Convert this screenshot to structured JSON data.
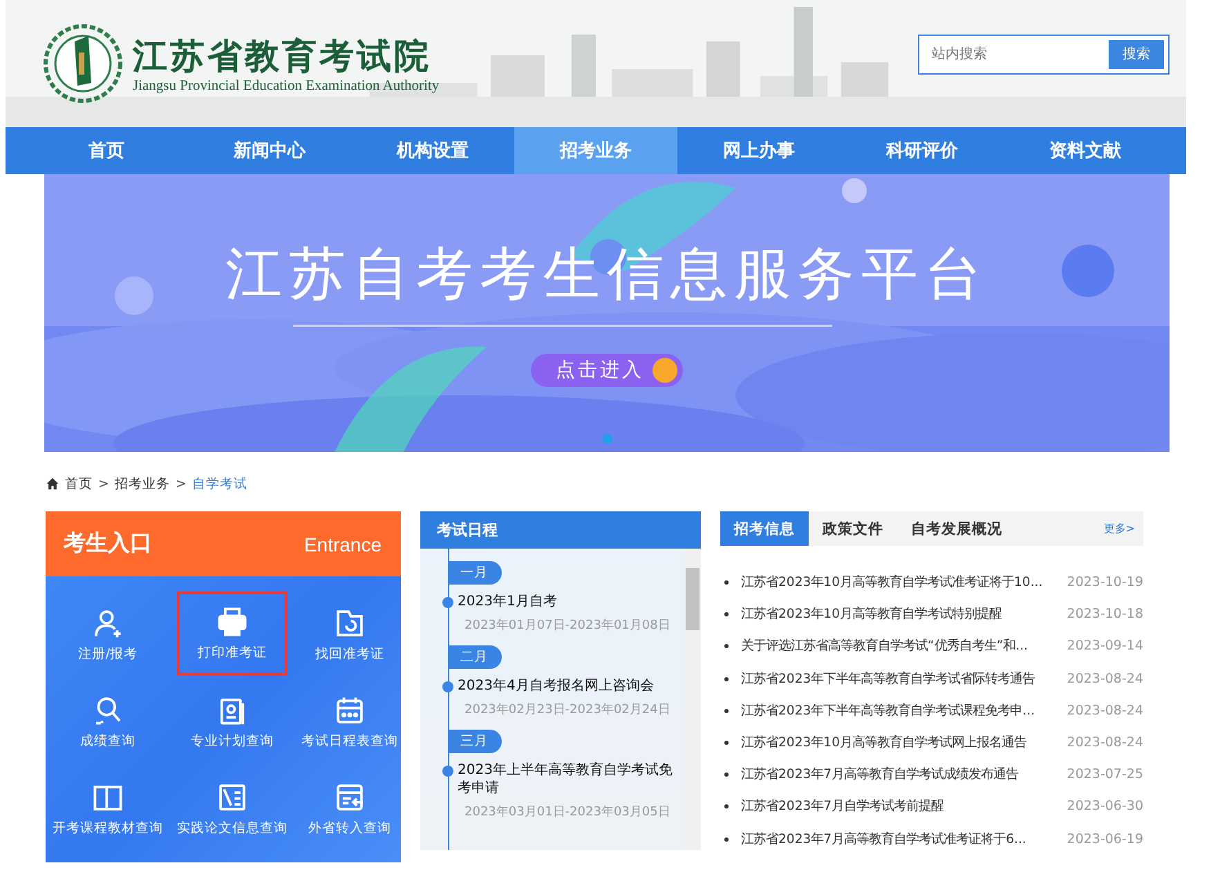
{
  "header": {
    "site_name": "江苏省教育考试院",
    "site_name_en": "Jiangsu Provincial Education Examination Authority",
    "search": {
      "placeholder": "站内搜索",
      "button": "搜索"
    }
  },
  "nav": [
    {
      "label": "首页",
      "selected": false
    },
    {
      "label": "新闻中心",
      "selected": false
    },
    {
      "label": "机构设置",
      "selected": false
    },
    {
      "label": "招考业务",
      "selected": true
    },
    {
      "label": "网上办事",
      "selected": false
    },
    {
      "label": "科研评价",
      "selected": false
    },
    {
      "label": "资料文献",
      "selected": false
    }
  ],
  "banner": {
    "title": "江苏自考考生信息服务平台",
    "button": "点击进入"
  },
  "breadcrumb": {
    "separator": ">",
    "items": [
      {
        "label": "首页",
        "current": false
      },
      {
        "label": "招考业务",
        "current": false
      },
      {
        "label": "自学考试",
        "current": true
      }
    ]
  },
  "entrance": {
    "title": "考生入口",
    "title_en": "Entrance",
    "items": [
      {
        "label": "注册/报考",
        "highlighted": false
      },
      {
        "label": "打印准考证",
        "highlighted": true
      },
      {
        "label": "找回准考证",
        "highlighted": false
      },
      {
        "label": "成绩查询",
        "highlighted": false
      },
      {
        "label": "专业计划查询",
        "highlighted": false
      },
      {
        "label": "考试日程表查询",
        "highlighted": false
      },
      {
        "label": "开考课程教材查询",
        "highlighted": false
      },
      {
        "label": "实践论文信息查询",
        "highlighted": false
      },
      {
        "label": "外省转入查询",
        "highlighted": false
      }
    ]
  },
  "schedule": {
    "title": "考试日程",
    "months": [
      {
        "month": "一月",
        "event": "2023年1月自考",
        "dates": "2023年01月07日-2023年01月08日"
      },
      {
        "month": "二月",
        "event": "2023年4月自考报名网上咨询会",
        "dates": "2023年02月23日-2023年02月24日"
      },
      {
        "month": "三月",
        "event": "2023年上半年高等教育自学考试免考申请",
        "dates": "2023年03月01日-2023年03月05日"
      }
    ]
  },
  "news": {
    "tabs": [
      {
        "label": "招考信息",
        "selected": true
      },
      {
        "label": "政策文件",
        "selected": false
      },
      {
        "label": "自考发展概况",
        "selected": false
      }
    ],
    "more": "更多>",
    "items": [
      {
        "title": "江苏省2023年10月高等教育自学考试准考证将于10...",
        "date": "2023-10-19"
      },
      {
        "title": "江苏省2023年10月高等教育自学考试特别提醒",
        "date": "2023-10-18"
      },
      {
        "title": "关于评选江苏省高等教育自学考试“优秀自考生”和...",
        "date": "2023-09-14"
      },
      {
        "title": "江苏省2023年下半年高等教育自学考试省际转考通告",
        "date": "2023-08-24"
      },
      {
        "title": "江苏省2023年下半年高等教育自学考试课程免考申...",
        "date": "2023-08-24"
      },
      {
        "title": "江苏省2023年10月高等教育自学考试网上报名通告",
        "date": "2023-08-24"
      },
      {
        "title": "江苏省2023年7月高等教育自学考试成绩发布通告",
        "date": "2023-07-25"
      },
      {
        "title": "江苏省2023年7月自学考试考前提醒",
        "date": "2023-06-30"
      },
      {
        "title": "江苏省2023年7月高等教育自学考试准考证将于6...",
        "date": "2023-06-19"
      }
    ]
  }
}
